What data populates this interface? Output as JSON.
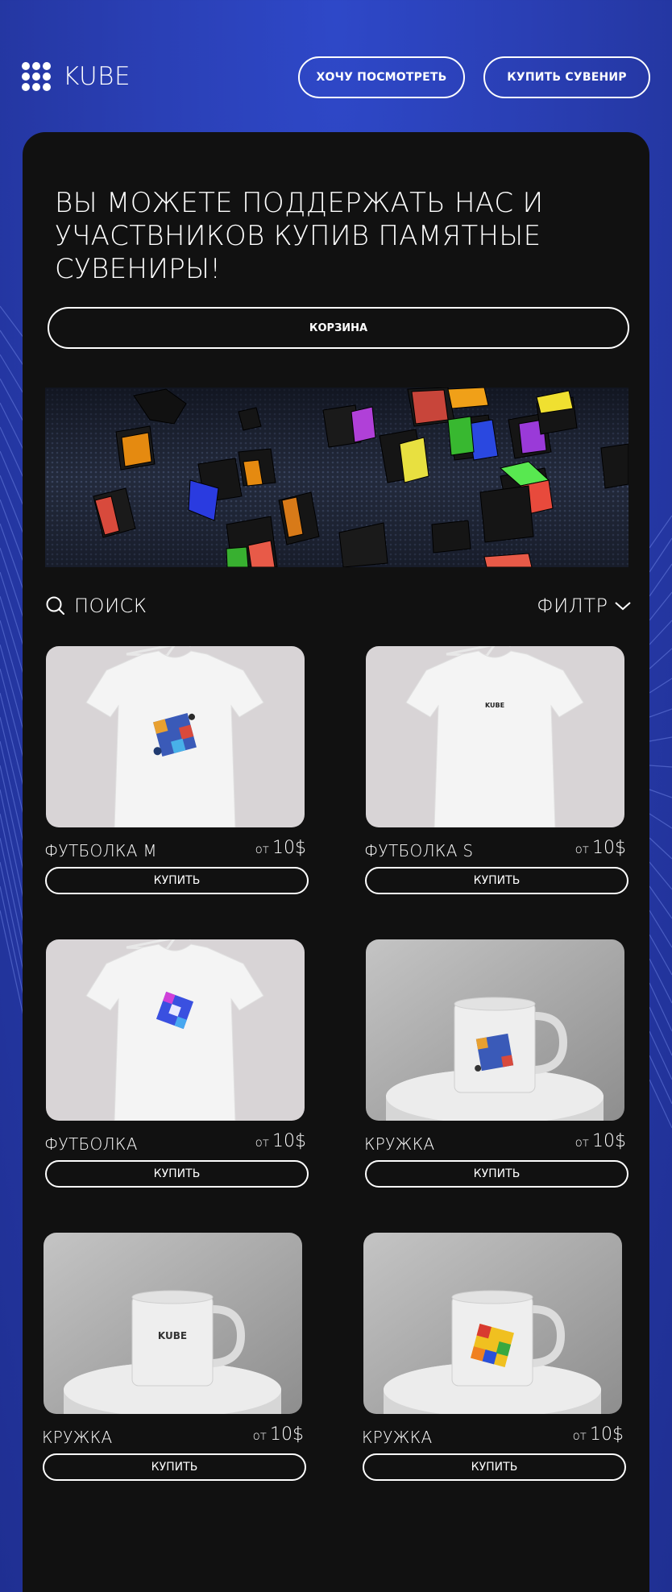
{
  "header": {
    "logo_text": "KUBE",
    "btn_watch": "ХОЧУ ПОСМОТРЕТЬ",
    "btn_buy": "КУПИТЬ СУВЕНИР"
  },
  "hero": {
    "title": "ВЫ МОЖЕТЕ ПОДДЕРЖАТЬ НАС И УЧАСТВНИКОВ КУПИВ ПАМЯТНЫЕ СУВЕНИРЫ!",
    "cart_label": "КОРЗИНА"
  },
  "toolbar": {
    "search_label": "ПОИСК",
    "filter_label": "ФИЛТР"
  },
  "products": [
    {
      "name": "ФУТБОЛКА  M",
      "price_prefix": "от",
      "price": "10$",
      "buy_label": "КУПИТЬ",
      "kind": "tshirt",
      "print": "cube-splash"
    },
    {
      "name": "ФУТБОЛКА  S",
      "price_prefix": "от",
      "price": "10$",
      "buy_label": "КУПИТЬ",
      "kind": "tshirt",
      "print": "kube-logo",
      "print_text": "KUBE"
    },
    {
      "name": "ФУТБОЛКА",
      "price_prefix": "от",
      "price": "10$",
      "buy_label": "КУПИТЬ",
      "kind": "tshirt",
      "print": "cube-blue"
    },
    {
      "name": "КРУЖКА",
      "price_prefix": "от",
      "price": "10$",
      "buy_label": "КУПИТЬ",
      "kind": "mug",
      "print": "cube-splash"
    },
    {
      "name": "КРУЖКА",
      "price_prefix": "от",
      "price": "10$",
      "buy_label": "КУПИТЬ",
      "kind": "mug",
      "print": "kube-logo",
      "print_text": "KUBE"
    },
    {
      "name": "КРУЖКА",
      "price_prefix": "от",
      "price": "10$",
      "buy_label": "КУПИТЬ",
      "kind": "mug",
      "print": "cube-color"
    }
  ],
  "colors": {
    "background": "#2a3fb4",
    "panel": "#111111",
    "text": "#ffffff"
  }
}
